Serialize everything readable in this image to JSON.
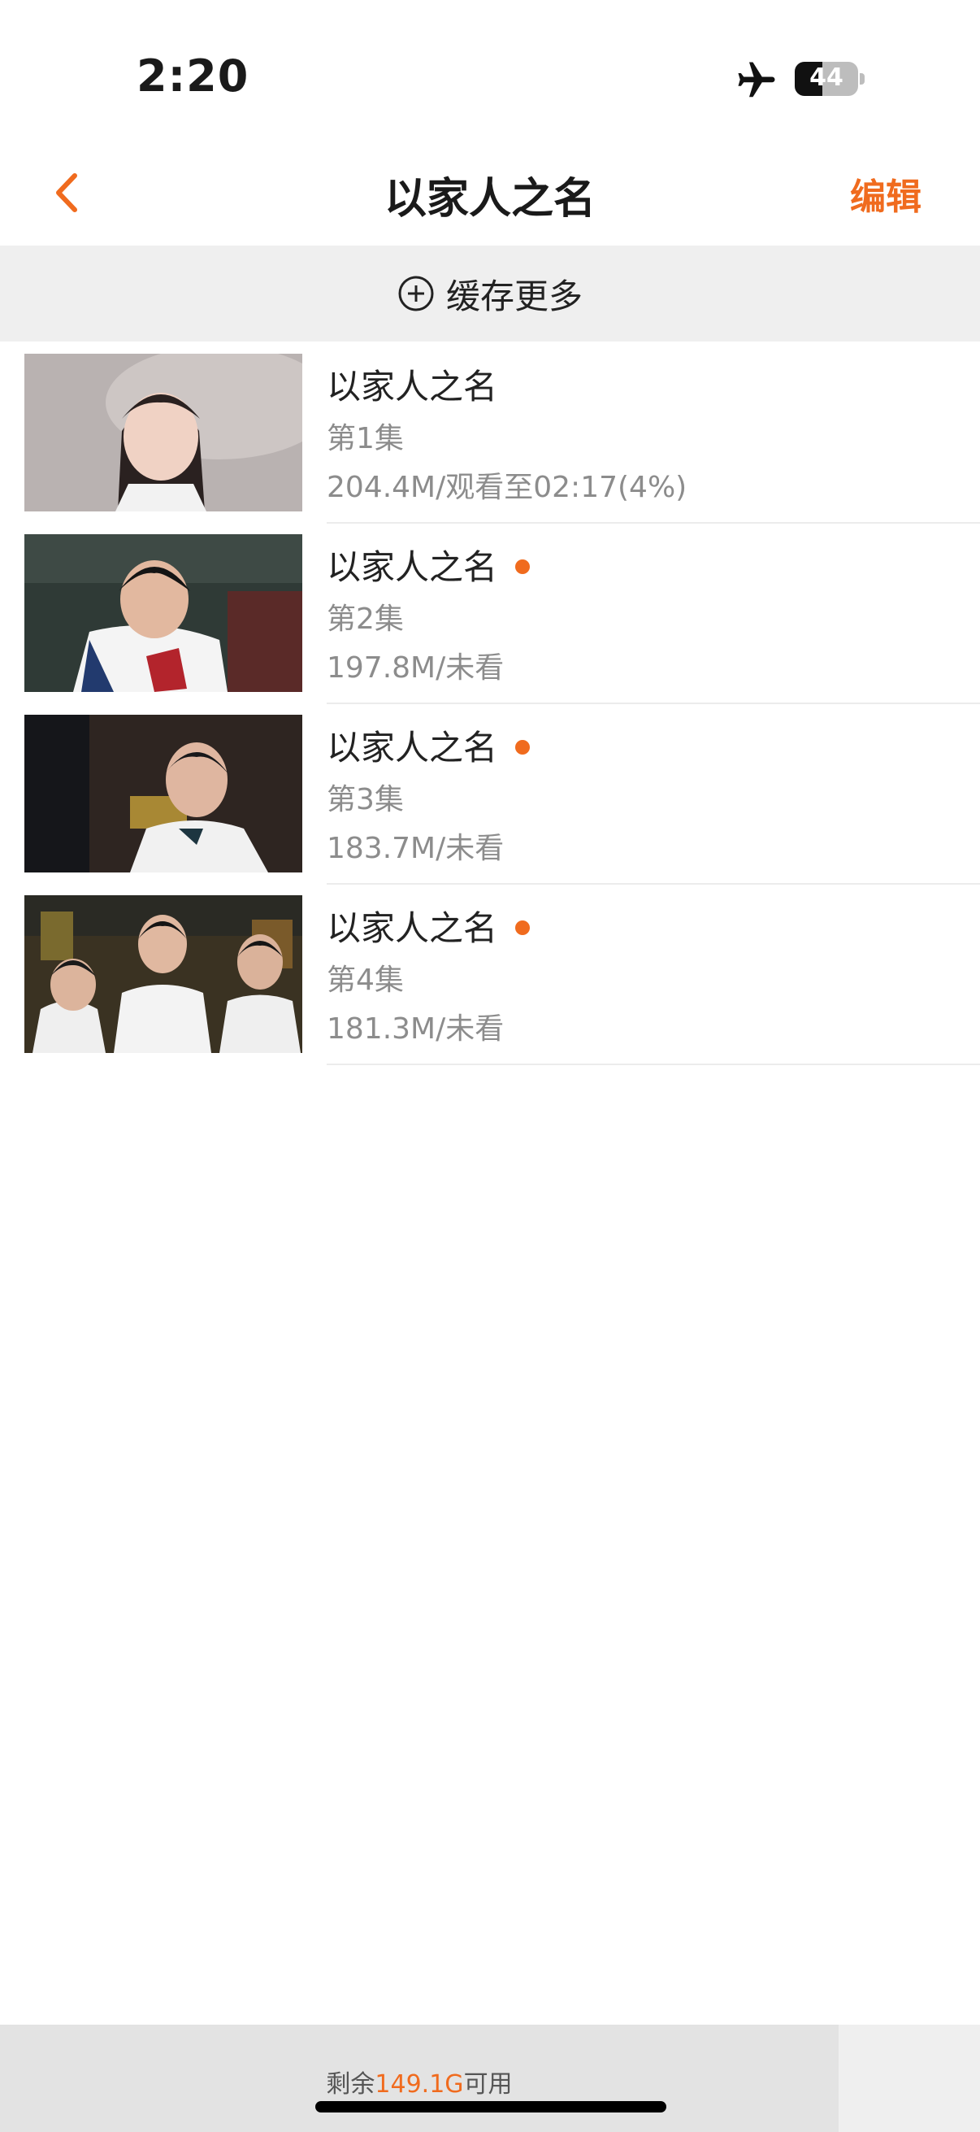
{
  "status_bar": {
    "time": "2:20",
    "airplane_icon": "airplane-icon",
    "battery_percent": 44,
    "battery_label": "44"
  },
  "nav": {
    "back_icon": "chevron-left-icon",
    "title": "以家人之名",
    "edit_label": "编辑"
  },
  "cache_more": {
    "icon": "plus-circle-icon",
    "label": "缓存更多"
  },
  "episodes": [
    {
      "title": "以家人之名",
      "episode": "第1集",
      "meta": "204.4M/观看至02:17(4%)",
      "is_new": false
    },
    {
      "title": "以家人之名",
      "episode": "第2集",
      "meta": "197.8M/未看",
      "is_new": true
    },
    {
      "title": "以家人之名",
      "episode": "第3集",
      "meta": "183.7M/未看",
      "is_new": true
    },
    {
      "title": "以家人之名",
      "episode": "第4集",
      "meta": "181.3M/未看",
      "is_new": true
    }
  ],
  "storage": {
    "prefix": "剩余",
    "value": "149.1G",
    "suffix": "可用"
  },
  "colors": {
    "accent": "#f06b1e",
    "secondary_text": "#8c8c8c",
    "section_bg": "#efefef"
  }
}
